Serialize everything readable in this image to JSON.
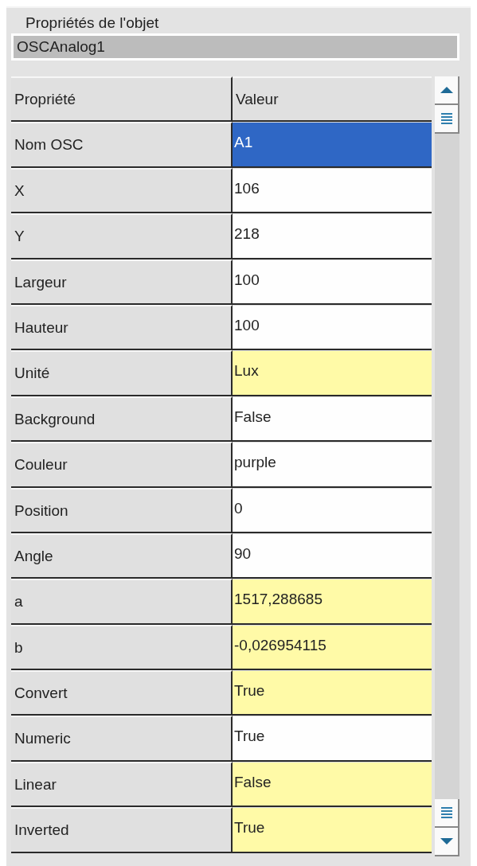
{
  "group": {
    "title": "Propriétés de l'objet",
    "object_name": "OSCAnalog1"
  },
  "grid": {
    "columns": [
      "Propriété",
      "Valeur"
    ],
    "rows": [
      {
        "property": "Nom OSC",
        "value": "A1",
        "selected": true,
        "highlighted": false
      },
      {
        "property": "X",
        "value": "106",
        "selected": false,
        "highlighted": false
      },
      {
        "property": "Y",
        "value": "218",
        "selected": false,
        "highlighted": false
      },
      {
        "property": "Largeur",
        "value": "100",
        "selected": false,
        "highlighted": false
      },
      {
        "property": "Hauteur",
        "value": "100",
        "selected": false,
        "highlighted": false
      },
      {
        "property": "Unité",
        "value": "Lux",
        "selected": false,
        "highlighted": true
      },
      {
        "property": "Background",
        "value": "False",
        "selected": false,
        "highlighted": false
      },
      {
        "property": "Couleur",
        "value": "purple",
        "selected": false,
        "highlighted": false
      },
      {
        "property": "Position",
        "value": "0",
        "selected": false,
        "highlighted": false
      },
      {
        "property": "Angle",
        "value": "90",
        "selected": false,
        "highlighted": false
      },
      {
        "property": "a",
        "value": "1517,288685",
        "selected": false,
        "highlighted": true
      },
      {
        "property": "b",
        "value": "-0,026954115",
        "selected": false,
        "highlighted": true
      },
      {
        "property": "Convert",
        "value": "True",
        "selected": false,
        "highlighted": true
      },
      {
        "property": "Numeric",
        "value": "True",
        "selected": false,
        "highlighted": false
      },
      {
        "property": "Linear",
        "value": "False",
        "selected": false,
        "highlighted": true
      },
      {
        "property": "Inverted",
        "value": "True",
        "selected": false,
        "highlighted": true
      }
    ]
  }
}
